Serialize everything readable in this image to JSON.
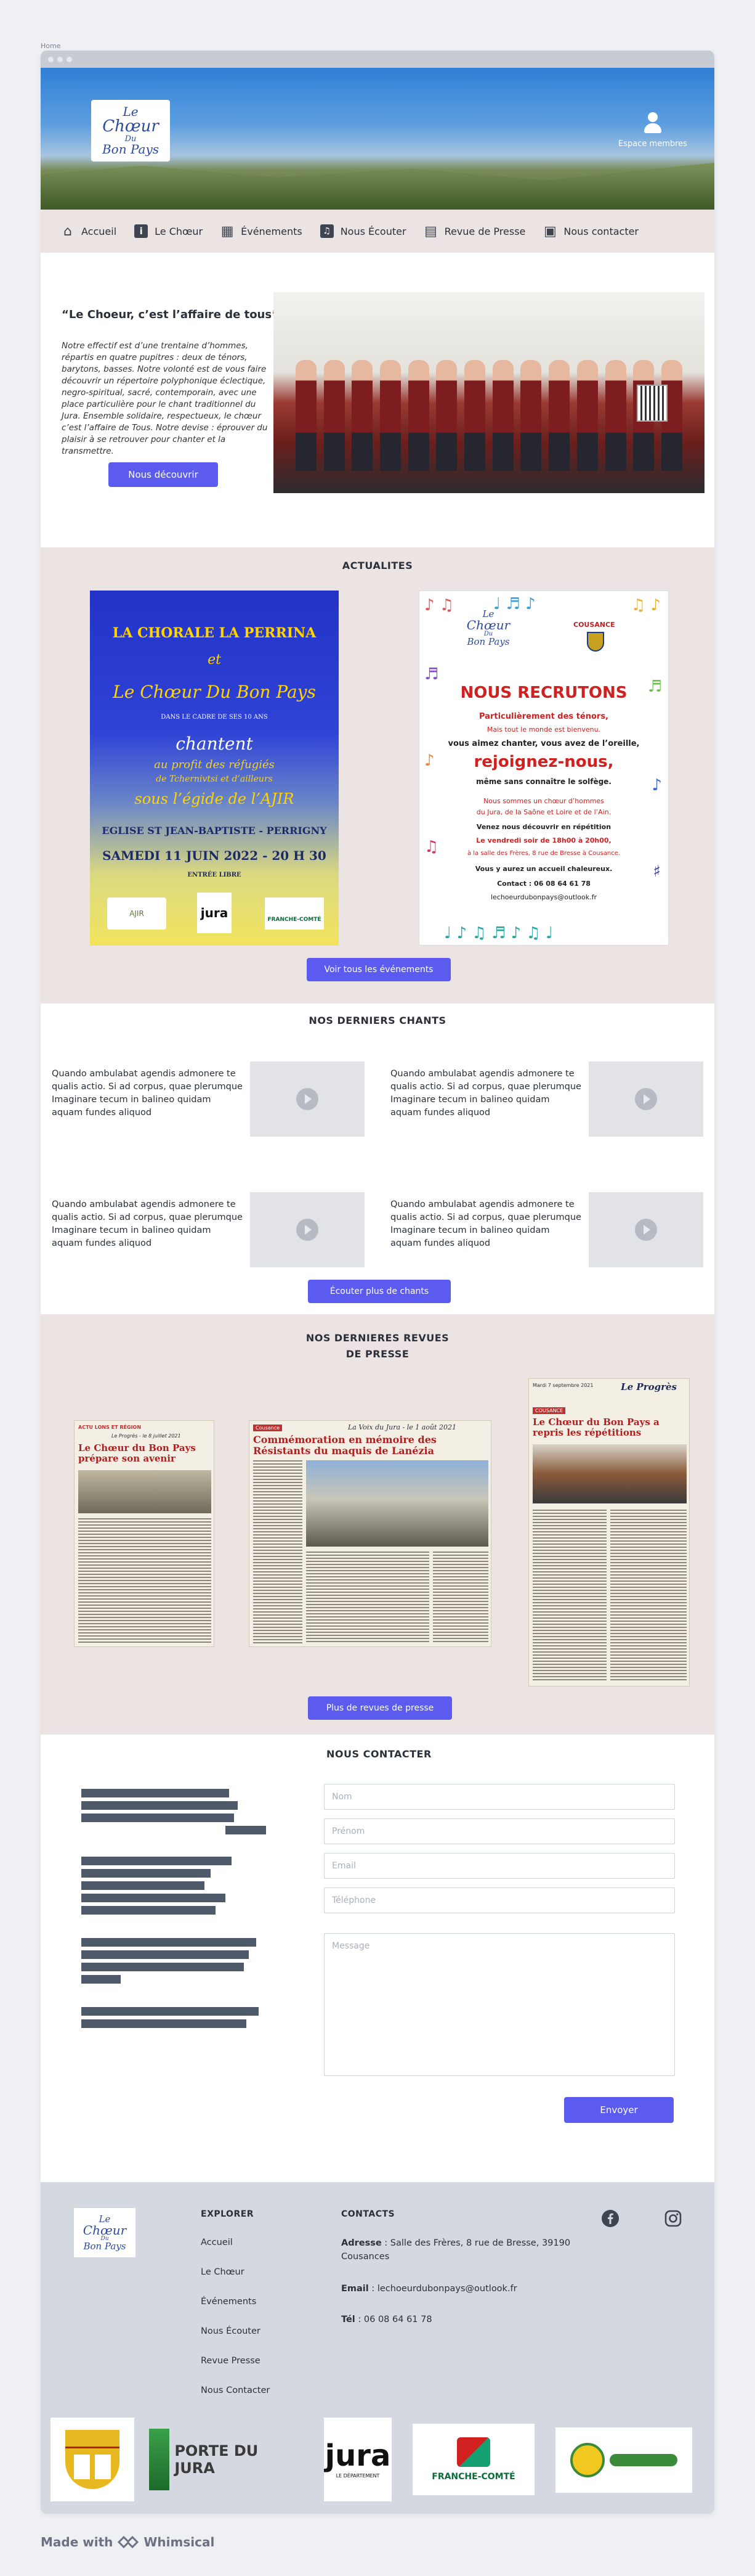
{
  "breadcrumb": "Home",
  "header": {
    "logo_line1": "Le",
    "logo_line2": "Chœur",
    "logo_line3": "Du",
    "logo_line4": "Bon Pays",
    "member_label": "Espace membres"
  },
  "nav": [
    {
      "label": "Accueil",
      "icon": "home-icon"
    },
    {
      "label": "Le Chœur",
      "icon": "info-icon"
    },
    {
      "label": "Événements",
      "icon": "calendar-icon"
    },
    {
      "label": "Nous Écouter",
      "icon": "music-icon"
    },
    {
      "label": "Revue de Presse",
      "icon": "newspaper-icon"
    },
    {
      "label": "Nous contacter",
      "icon": "contact-icon"
    }
  ],
  "intro": {
    "title": "“Le Choeur, c’est l’affaire de tous”",
    "text": "Notre effectif est d’une trentaine d’hommes, répartis en quatre pupitres : deux de ténors, barytons, basses. Notre volonté est de vous faire découvrir un répertoire polyphonique éclectique, negro-spiritual, sacré, contemporain, avec une place particulière pour le chant traditionnel du Jura. Ensemble solidaire, respectueux, le chœur c’est l’affaire de Tous. Notre devise : éprouver du plaisir à se retrouver pour chanter et la transmettre.",
    "button": "Nous découvrir"
  },
  "actualites": {
    "title": "ACTUALITES",
    "poster1": {
      "l1": "LA CHORALE LA PERRINA",
      "l2": "et",
      "l3": "Le Chœur Du Bon Pays",
      "l4": "DANS LE CADRE DE SES 10 ANS",
      "l5": "chantent",
      "l6": "au profit des réfugiés",
      "l7": "de Tchernivtsi et d’ailleurs",
      "l8": "sous l’égide de l’AJIR",
      "l9": "EGLISE ST JEAN-BAPTISTE - PERRIGNY",
      "l10": "SAMEDI 11 JUIN 2022 - 20 H 30",
      "l11": "ENTRÉE LIBRE",
      "logo1": "AJIR",
      "logo2": "jura",
      "logo3": "FRANCHE-COMTÉ"
    },
    "poster2": {
      "logo_l1": "Le",
      "logo_l2": "Chœur",
      "logo_l3": "Du",
      "logo_l4": "Bon Pays",
      "town": "COUSANCE",
      "l1": "NOUS RECRUTONS",
      "l2": "Particulièrement des ténors,",
      "l3": "Mais tout le monde est bienvenu.",
      "l4": "vous aimez chanter, vous avez de l’oreille,",
      "l5": "rejoignez-nous,",
      "l6": "même sans connaître le solfège.",
      "l7": "Nous sommes un chœur d’hommes",
      "l8": "du Jura, de la Saône et Loire et de l’Ain.",
      "l9": "Venez nous découvrir en répétition",
      "l10": "Le vendredi soir de 18h00 à 20h00,",
      "l11": "à la salle des Frères, 8 rue de Bresse à Cousance.",
      "l12": "Vous y aurez un accueil chaleureux.",
      "l13": "Contact : 06 08 64 61 78",
      "l14": "lechoeurdubonpays@outlook.fr"
    },
    "button": "Voir tous les événements"
  },
  "chants": {
    "title": "NOS DERNIERS CHANTS",
    "items": [
      {
        "text": "Quando ambulabat agendis admonere te qualis actio. Si ad corpus, quae plerumque Imaginare tecum in balineo quidam aquam fundes aliquod"
      },
      {
        "text": "Quando ambulabat agendis admonere te qualis actio. Si ad corpus, quae plerumque Imaginare tecum in balineo quidam aquam fundes aliquod"
      },
      {
        "text": "Quando ambulabat agendis admonere te qualis actio. Si ad corpus, quae plerumque Imaginare tecum in balineo quidam aquam fundes aliquod"
      },
      {
        "text": "Quando ambulabat agendis admonere te qualis actio. Si ad corpus, quae plerumque Imaginare tecum in balineo quidam aquam fundes aliquod"
      }
    ],
    "button": "Écouter plus de chants"
  },
  "presse": {
    "title_l1": "NOS DERNIERES REVUES",
    "title_l2": "DE PRESSE",
    "clip1": {
      "tag": "ACTU LONS ET RÉGION",
      "paper": "Le Progrès - le 8 juillet 2021",
      "headline": "Le Chœur du Bon Pays prépare son avenir"
    },
    "clip2": {
      "tag": "Cousance",
      "paper": "La Voix du Jura - le 1 août 2021",
      "headline": "Commémoration en mémoire des Résistants du maquis de Lanézia"
    },
    "clip3": {
      "date": "Mardi 7 septembre 2021",
      "paper": "Le Progrès",
      "tag": "COUSANCE",
      "headline": "Le Chœur du Bon Pays a repris les répétitions"
    },
    "button": "Plus de revues de presse"
  },
  "contact": {
    "title": "NOUS CONTACTER",
    "fields": [
      {
        "placeholder": "Nom"
      },
      {
        "placeholder": "Prénom"
      },
      {
        "placeholder": "Email"
      },
      {
        "placeholder": "Téléphone"
      }
    ],
    "message_placeholder": "Message",
    "button": "Envoyer"
  },
  "footer": {
    "logo_l1": "Le",
    "logo_l2": "Chœur",
    "logo_l3": "Du",
    "logo_l4": "Bon Pays",
    "explorer_title": "EXPLORER",
    "links": [
      "Accueil",
      "Le Chœur",
      "Événements",
      "Nous Écouter",
      "Revue Presse",
      "Nous Contacter"
    ],
    "contacts_title": "CONTACTS",
    "address_label": "Adresse",
    "address": " : Salle des Frères, 8 rue de Bresse, 39190 Cousances",
    "email_label": "Email",
    "email": " : lechoeurdubonpays@outlook.fr",
    "tel_label": "Tél",
    "tel": " : 06 08 64 61 78",
    "partners": [
      "PORTE DU JURA",
      "jura",
      "LE DÉPARTEMENT",
      "FRANCHE-COMTÉ"
    ]
  },
  "made_with": {
    "prefix": "Made with",
    "brand": "Whimsical"
  },
  "colors": {
    "accent": "#5b5bef",
    "band": "#ece3e3",
    "footer": "#d4d8e0"
  }
}
